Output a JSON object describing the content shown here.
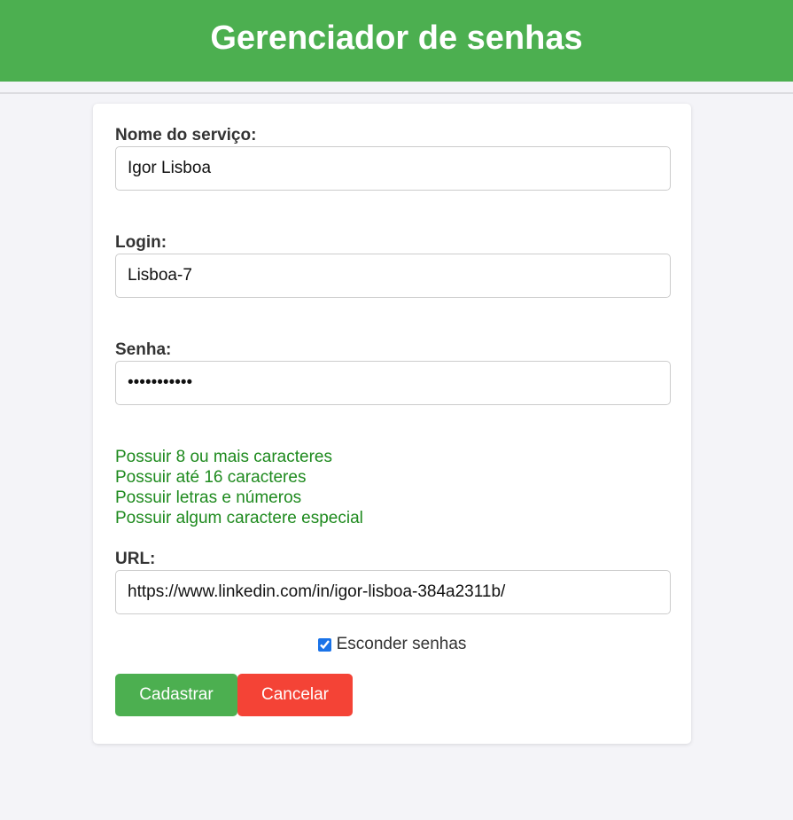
{
  "header": {
    "title": "Gerenciador de senhas"
  },
  "form": {
    "service": {
      "label": "Nome do serviço:",
      "value": "Igor Lisboa"
    },
    "login": {
      "label": "Login:",
      "value": "Lisboa-7"
    },
    "password": {
      "label": "Senha:",
      "value": "Senha@2023!"
    },
    "rules": [
      "Possuir 8 ou mais caracteres",
      "Possuir até 16 caracteres",
      "Possuir letras e números",
      "Possuir algum caractere especial"
    ],
    "url": {
      "label": "URL:",
      "value": "https://www.linkedin.com/in/igor-lisboa-384a2311b/"
    },
    "hide_passwords": {
      "label": "Esconder senhas",
      "checked": true
    },
    "buttons": {
      "submit": "Cadastrar",
      "cancel": "Cancelar"
    }
  },
  "colors": {
    "header_bg": "#4caf50",
    "rule_valid": "#1e8a1e",
    "submit_bg": "#4caf50",
    "cancel_bg": "#f44336",
    "page_bg": "#f4f4f8"
  }
}
